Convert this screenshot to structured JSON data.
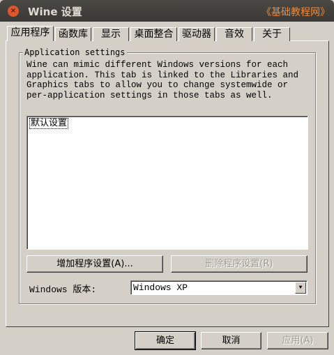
{
  "window": {
    "title": "Wine 设置",
    "watermark": "《基础教程网》"
  },
  "tabs": [
    "应用程序",
    "函数库",
    "显示",
    "桌面整合",
    "驱动器",
    "音效",
    "关于"
  ],
  "group": {
    "label": "Application settings",
    "description": [
      "Wine can mimic different Windows versions for each",
      "application. This tab is linked to the Libraries and",
      "Graphics tabs to allow you to change systemwide or",
      "per-application settings in those tabs as well."
    ],
    "list_items": [
      "默认设置"
    ],
    "add_button": "增加程序设置(A)...",
    "remove_button": "删除程序设置(R)",
    "version_label": "Windows 版本:",
    "version_value": "Windows XP"
  },
  "footer": {
    "ok": "确定",
    "cancel": "取消",
    "apply": "应用(A)"
  }
}
